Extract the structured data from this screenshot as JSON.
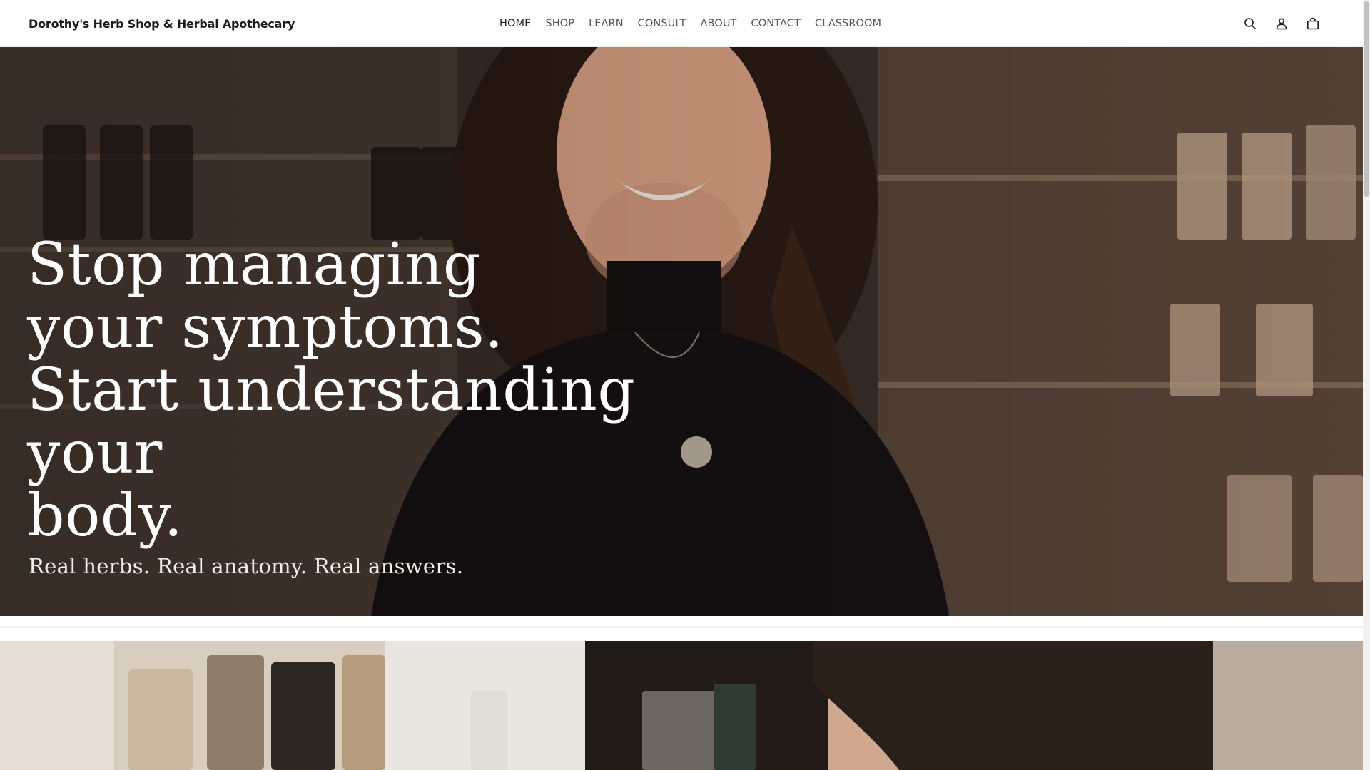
{
  "header": {
    "brand": "Dorothy's Herb Shop & Herbal Apothecary",
    "nav": [
      {
        "label": "HOME",
        "active": true
      },
      {
        "label": "SHOP",
        "active": false
      },
      {
        "label": "LEARN",
        "active": false
      },
      {
        "label": "CONSULT",
        "active": false
      },
      {
        "label": "ABOUT",
        "active": false
      },
      {
        "label": "CONTACT",
        "active": false
      },
      {
        "label": "CLASSROOM",
        "active": false
      }
    ],
    "icons": [
      "search-icon",
      "account-icon",
      "cart-icon"
    ]
  },
  "hero": {
    "title_lines": [
      "Stop managing",
      "your symptoms.",
      "Start understanding your",
      "body."
    ],
    "subtitle": "Real herbs. Real anatomy. Real answers."
  },
  "colors": {
    "header_bg": "#ffffff",
    "nav_text": "#555555",
    "nav_active": "#1c1c1c",
    "hero_text": "#ffffff"
  }
}
